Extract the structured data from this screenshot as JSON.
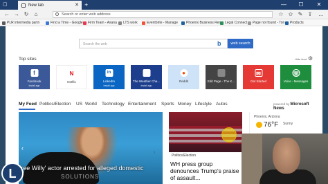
{
  "tab": {
    "title": "New tab"
  },
  "window": {
    "minimize": "—",
    "maximize": "☐",
    "close": "✕"
  },
  "navbar": {
    "address_placeholder": "Search or enter web address"
  },
  "favorites": [
    {
      "label": "PLR intermedia partn",
      "color": "#5a5a5a"
    },
    {
      "label": "Find a Time - Google",
      "color": "#3c78d8"
    },
    {
      "label": "Firm Team - Asana",
      "color": "#e8384f"
    },
    {
      "label": "LTS work",
      "color": "#888"
    },
    {
      "label": "Eventbrite - Manage",
      "color": "#f05537"
    },
    {
      "label": "Phoenix Business Rec",
      "color": "#1f5fa0"
    },
    {
      "label": "Legal Connect",
      "color": "#2d8f5a"
    },
    {
      "label": "Page not found - Ton",
      "color": "#999"
    },
    {
      "label": "Products",
      "color": "#1f5fa0"
    }
  ],
  "search": {
    "placeholder": "Search the web",
    "button": "web search"
  },
  "top_sites": {
    "title": "Top sites",
    "hide_feed": "Hide feed",
    "tiles": [
      {
        "label": "Facebook",
        "sub": "Install app",
        "color": "#3b5998",
        "glyph": "f"
      },
      {
        "label": "Netflix",
        "sub": "",
        "color": "#ffffff",
        "glyph": "N"
      },
      {
        "label": "LinkedIn",
        "sub": "Install app",
        "color": "#0a66c2",
        "glyph": "in"
      },
      {
        "label": "The Weather Cha...",
        "sub": "Install app",
        "color": "#1d3e8c",
        "glyph": ""
      },
      {
        "label": "Reddit",
        "sub": "",
        "color": "#cee3f8",
        "glyph": ""
      },
      {
        "label": "Edit Page - The K...",
        "sub": "",
        "color": "#444444",
        "glyph": ""
      },
      {
        "label": "Get Started",
        "sub": "",
        "color": "#e53935",
        "glyph": ""
      },
      {
        "label": "Voice - Messages",
        "sub": "",
        "color": "#1e8e3e",
        "glyph": ""
      }
    ]
  },
  "feed": {
    "items": [
      "My Feed",
      "Politics/Election",
      "US",
      "World",
      "Technology",
      "Entertainment",
      "Sports",
      "Money",
      "Lifestyle",
      "Autos"
    ],
    "powered_prefix": "powered by",
    "powered_brand": "Microsoft News"
  },
  "main_story": {
    "headline": "'Free Willy' actor arrested for alleged domestic",
    "watermark": "SOLUTIONS",
    "logo": "L"
  },
  "story2": {
    "category": "Politics/Election",
    "headline": "WH press group denounces Trump's praise of assault..."
  },
  "weather": {
    "location": "Phoenix, Arizona",
    "temp": "76°F",
    "condition": "Sunny"
  }
}
